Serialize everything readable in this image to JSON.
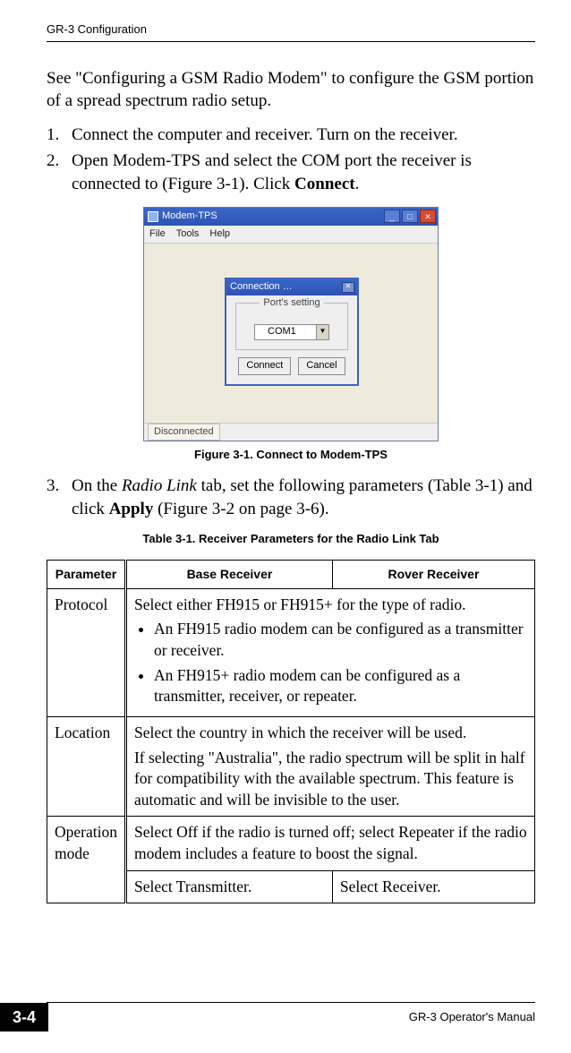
{
  "header": {
    "running_head": "GR-3 Configuration"
  },
  "para_intro": "See \"Configuring a GSM Radio Modem\" to configure the GSM portion of a spread spectrum radio setup.",
  "steps": {
    "s1": {
      "num": "1.",
      "text": "Connect the computer and receiver. Turn on the receiver."
    },
    "s2": {
      "num": "2.",
      "pre": "Open Modem-TPS and select the COM port the receiver is connected to (Figure 3-1). Click ",
      "bold": "Connect",
      "post": "."
    },
    "s3": {
      "num": "3.",
      "pre": "On the ",
      "ital": "Radio Link",
      "mid": " tab, set the following parameters (Table 3-1) and click ",
      "bold": "Apply",
      "post": " (Figure 3-2 on page 3-6)."
    }
  },
  "figure": {
    "caption": "Figure 3-1. Connect to Modem-TPS"
  },
  "app": {
    "title": "Modem-TPS",
    "menu": {
      "file": "File",
      "tools": "Tools",
      "help": "Help"
    },
    "dialog": {
      "title": "Connection …",
      "legend": "Port's setting",
      "combo_value": "COM1",
      "connect": "Connect",
      "cancel": "Cancel"
    },
    "status": "Disconnected"
  },
  "table": {
    "caption": "Table 3-1. Receiver Parameters for the Radio Link Tab",
    "head": {
      "param": "Parameter",
      "base": "Base Receiver",
      "rover": "Rover Receiver"
    },
    "rows": {
      "protocol": {
        "name": "Protocol",
        "intro": "Select either FH915 or FH915+ for the type of radio.",
        "b1": "An FH915 radio modem can be configured as a transmitter or receiver.",
        "b2": "An FH915+ radio modem can be configured as a transmitter, receiver, or repeater."
      },
      "location": {
        "name": "Location",
        "l1": "Select the country in which the receiver will be used.",
        "l2": "If selecting \"Australia\", the radio spectrum will be split in half for compatibility with the available spectrum. This feature is automatic and will be invisible to the user."
      },
      "opmode": {
        "name": "Operation mode",
        "shared": "Select Off if the radio is turned off; select Repeater if the radio modem includes a feature to boost the signal.",
        "base": "Select Transmitter.",
        "rover": "Select Receiver."
      }
    }
  },
  "footer": {
    "page": "3-4",
    "right": "GR-3 Operator's Manual"
  }
}
